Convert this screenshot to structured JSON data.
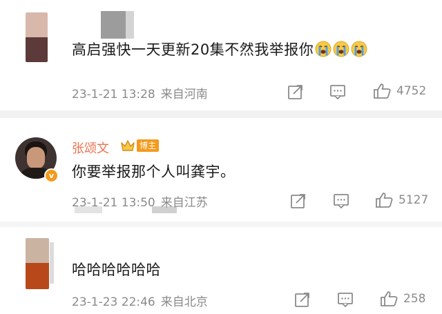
{
  "comments": [
    {
      "text": "高启强快一天更新20集不然我举报你",
      "emojis": [
        "crying-face",
        "crying-face",
        "crying-face"
      ],
      "date": "23-1-21 13:28",
      "location": "来自河南",
      "likes": "4752"
    },
    {
      "username": "张颂文",
      "badge": "博主",
      "text": "你要举报那个人叫龚宇。",
      "date": "23-1-21 13:50",
      "location": "来自江苏",
      "likes": "5127"
    },
    {
      "text": "哈哈哈哈哈哈",
      "date": "23-1-23 22:46",
      "location": "来自北京",
      "likes": "258"
    }
  ],
  "colors": {
    "username": "#eb7350",
    "meta": "#8a8a8a",
    "badge": "#f39a1c",
    "separator": "#f2f2f2"
  }
}
